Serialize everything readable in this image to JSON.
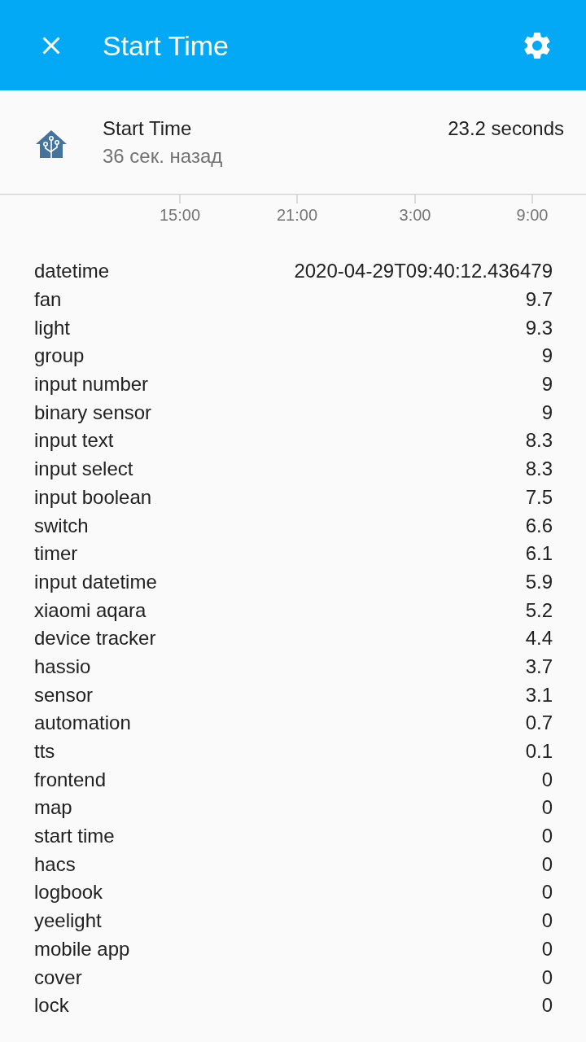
{
  "header": {
    "title": "Start Time"
  },
  "entity": {
    "name": "Start Time",
    "time_ago": "36 сек. назад",
    "state": "23.2 seconds"
  },
  "chart": {
    "xticks": [
      "15:00",
      "21:00",
      "3:00",
      "9:00"
    ]
  },
  "attributes": [
    {
      "name": "datetime",
      "value": "2020-04-29T09:40:12.436479"
    },
    {
      "name": "fan",
      "value": "9.7"
    },
    {
      "name": "light",
      "value": "9.3"
    },
    {
      "name": "group",
      "value": "9"
    },
    {
      "name": "input number",
      "value": "9"
    },
    {
      "name": "binary sensor",
      "value": "9"
    },
    {
      "name": "input text",
      "value": "8.3"
    },
    {
      "name": "input select",
      "value": "8.3"
    },
    {
      "name": "input boolean",
      "value": "7.5"
    },
    {
      "name": "switch",
      "value": "6.6"
    },
    {
      "name": "timer",
      "value": "6.1"
    },
    {
      "name": "input datetime",
      "value": "5.9"
    },
    {
      "name": "xiaomi aqara",
      "value": "5.2"
    },
    {
      "name": "device tracker",
      "value": "4.4"
    },
    {
      "name": "hassio",
      "value": "3.7"
    },
    {
      "name": "sensor",
      "value": "3.1"
    },
    {
      "name": "automation",
      "value": "0.7"
    },
    {
      "name": "tts",
      "value": "0.1"
    },
    {
      "name": "frontend",
      "value": "0"
    },
    {
      "name": "map",
      "value": "0"
    },
    {
      "name": "start time",
      "value": "0"
    },
    {
      "name": "hacs",
      "value": "0"
    },
    {
      "name": "logbook",
      "value": "0"
    },
    {
      "name": "yeelight",
      "value": "0"
    },
    {
      "name": "mobile app",
      "value": "0"
    },
    {
      "name": "cover",
      "value": "0"
    },
    {
      "name": "lock",
      "value": "0"
    }
  ]
}
